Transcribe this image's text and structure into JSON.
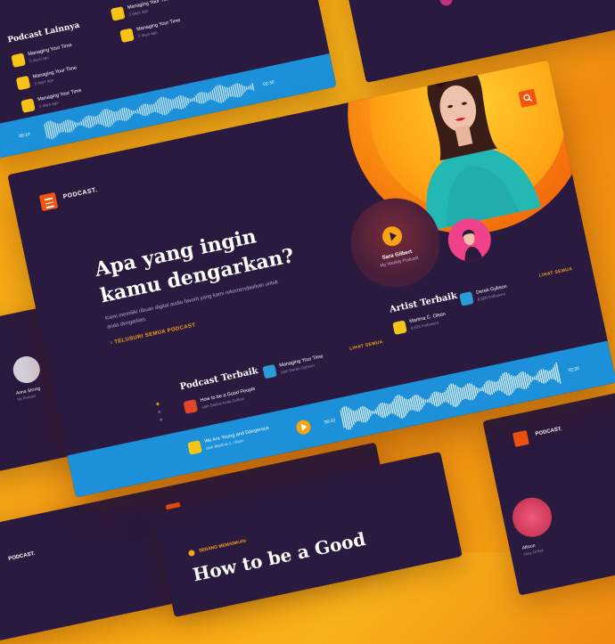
{
  "brand": "PODCAST.",
  "hero": {
    "title": "Apa yang ingin kamu dengarkan?",
    "desc": "Kami memiliki ribuan digital audio favorit yang kami rekomendasikan untuk anda dengarkan.",
    "link": "› TELUSURI SEMUA PODCAST"
  },
  "featured_host": {
    "name": "Sara Gilbert",
    "show": "My Weekly Podcast"
  },
  "podcast_terbaik": {
    "title": "Podcast Terbaik",
    "see_all": "LIHAT SEMUA",
    "items": [
      {
        "title": "How to be a Good People",
        "sub": "oleh Sasha Anita Zefkas",
        "color": "#e2462a"
      },
      {
        "title": "Managing Your Time",
        "sub": "oleh Derek Gybson",
        "color": "#2a9bd8"
      }
    ]
  },
  "artist_terbaik": {
    "title": "Artist Terbaik",
    "see_all": "LIHAT SEMUA",
    "items": [
      {
        "name": "Martina C. Olson",
        "followers": "8,520 Followers",
        "color": "#f6c417"
      },
      {
        "name": "Derek Gybson",
        "followers": "8,500 Followers",
        "color": "#2a9bd8"
      }
    ]
  },
  "player": {
    "now_playing": {
      "title": "We Are Young and Dangerous",
      "sub": "oleh Martina C. Olson"
    },
    "time_start": "00:10",
    "time_end": "02:30"
  },
  "ghost_top": {
    "title": "Podcast Lainnya",
    "items": [
      {
        "title": "Managing Your Time",
        "sub": "2 days ago"
      },
      {
        "title": "Managing Your Time",
        "sub": "2 days ago"
      },
      {
        "title": "Managing Your Time",
        "sub": "2 days ago"
      },
      {
        "title": "Managing Your Time",
        "sub": "2 days ago"
      },
      {
        "title": "Managing Your Time",
        "sub": "2 days ago"
      }
    ],
    "time_start": "00:10",
    "time_end": "02:30"
  },
  "ghost_left": {
    "name": "Anna Strong",
    "sub": "My Podcast"
  },
  "ghost_bottom": {
    "label": "SEDANG MEMAINKAN",
    "title": "How to be a Good"
  },
  "ghost_right": {
    "brand": "PODCAST.",
    "name": "Allison",
    "sub": "Story Of Bail"
  },
  "ghost_bottom_left": {
    "brand": "PODCAST."
  },
  "colors": {
    "accent": "#f6a414",
    "red": "#f2540f",
    "bg": "#2a1a3f",
    "player": "#1c90d8"
  }
}
